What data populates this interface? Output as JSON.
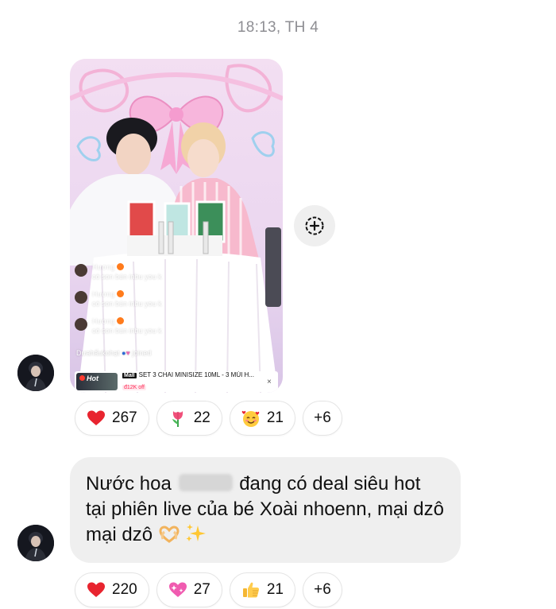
{
  "timestamp": "18:13, TH 4",
  "reel": {
    "comments": [
      {
        "user": "Hương",
        "text": "có son bún inbu you k"
      },
      {
        "user": "Hương",
        "text": "có son bún inbu you k"
      },
      {
        "user": "Hương",
        "text": "có son bún inbu you k"
      }
    ],
    "joined_user": "Dưahấukohạt",
    "joined_label": "joined",
    "hot_label": "Hot",
    "mall_tag": "Mall",
    "product_title": "SET 3 CHAI MINISIZE 10ML - 3 MÙI H...",
    "product_discount": "đ12K off",
    "close": "×"
  },
  "reactions_1": [
    {
      "icon": "heart-icon",
      "count": "267"
    },
    {
      "icon": "tulip-icon",
      "count": "22"
    },
    {
      "icon": "smiling-face-with-hearts-icon",
      "count": "21"
    }
  ],
  "reactions_1_more": "+6",
  "message": {
    "part1": "Nước hoa",
    "part2": "đang có deal siêu hot tại phiên live của bé Xoài nhoenn, mại dzô mại dzô"
  },
  "reactions_2": [
    {
      "icon": "heart-icon",
      "count": "220"
    },
    {
      "icon": "sparkling-heart-icon",
      "count": "27"
    },
    {
      "icon": "thumbs-up-icon",
      "count": "21"
    }
  ],
  "reactions_2_more": "+6",
  "colors": {
    "bubble": "#efefef",
    "timestamp": "#8e8e93",
    "heart": "#e8242f"
  }
}
